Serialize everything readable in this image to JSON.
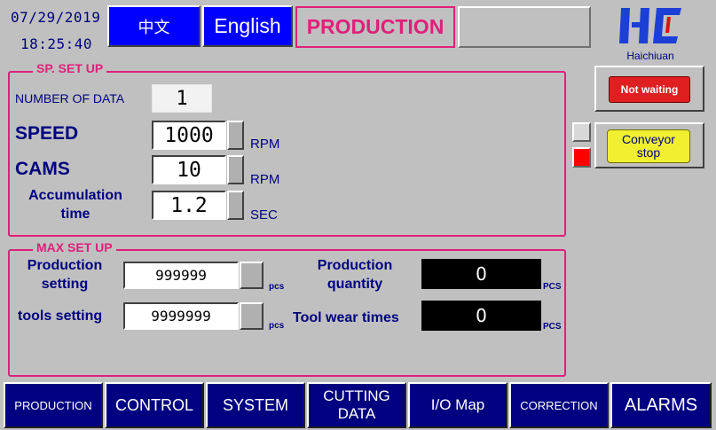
{
  "header": {
    "date": "07/29/2019",
    "time": "18:25:40",
    "lang_chinese": "中文",
    "lang_english": "English",
    "screen_title": "PRODUCTION",
    "brand": "Haichiuan"
  },
  "sp_setup": {
    "title": "SP. SET UP",
    "number_of_data_label": "NUMBER OF DATA",
    "number_of_data_value": "1",
    "speed_label": "SPEED",
    "speed_value": "1000",
    "speed_unit": "RPM",
    "cams_label": "CAMS",
    "cams_value": "10",
    "cams_unit": "RPM",
    "accumulation_label_1": "Accumulation",
    "accumulation_label_2": "time",
    "accumulation_value": "1.2",
    "accumulation_unit": "SEC"
  },
  "max_setup": {
    "title": "MAX SET UP",
    "production_setting_label_1": "Production",
    "production_setting_label_2": "setting",
    "production_setting_value": "999999",
    "production_setting_unit": "pcs",
    "tools_setting_label": "tools setting",
    "tools_setting_value": "9999999",
    "tools_setting_unit": "pcs",
    "production_quantity_label_1": "Production",
    "production_quantity_label_2": "quantity",
    "production_quantity_value": "0",
    "production_quantity_unit": "PCS",
    "tool_wear_label": "Tool wear times",
    "tool_wear_value": "0",
    "tool_wear_unit": "PCS"
  },
  "status": {
    "not_waiting": "Not waiting",
    "conveyor_1": "Conveyor",
    "conveyor_2": "stop"
  },
  "nav": [
    {
      "label": "PRODUCTION"
    },
    {
      "label": "CONTROL"
    },
    {
      "label": "SYSTEM"
    },
    {
      "label": "CUTTING",
      "label2": "DATA"
    },
    {
      "label": "I/O Map"
    },
    {
      "label": "CORRECTION"
    },
    {
      "label": "ALARMS"
    }
  ],
  "colors": {
    "accent": "#e0207a",
    "navy": "#000080",
    "panel": "#c0c0c0",
    "indicator_active": "#ff0000"
  }
}
